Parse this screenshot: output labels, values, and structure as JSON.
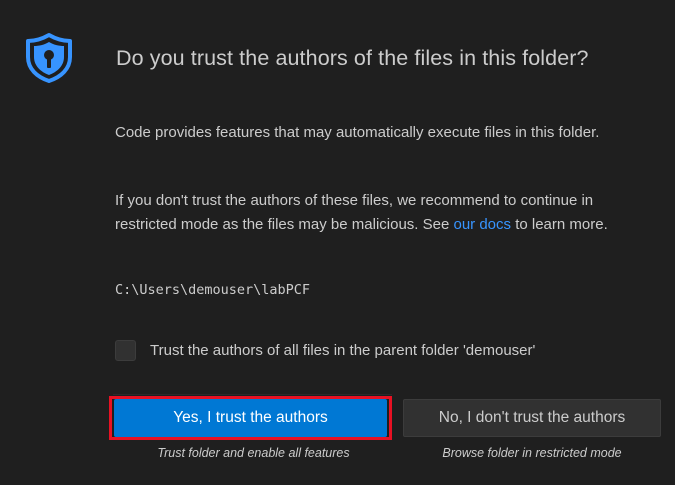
{
  "dialog": {
    "title": "Do you trust the authors of the files in this folder?",
    "paragraph1": "Code provides features that may automatically execute files in this folder.",
    "paragraph2_before_link": "If you don't trust the authors of these files, we recommend to continue in restricted mode as the files may be malicious. See ",
    "paragraph2_link": "our docs",
    "paragraph2_after_link": " to learn more.",
    "folder_path": "C:\\Users\\demouser\\labPCF",
    "parent_checkbox_label": "Trust the authors of all files in the parent folder 'demouser'",
    "parent_checkbox_checked": false,
    "trust_button_label": "Yes, I trust the authors",
    "trust_button_caption": "Trust folder and enable all features",
    "no_trust_button_label": "No, I don't trust the authors",
    "no_trust_button_caption": "Browse folder in restricted mode",
    "icon": "shield-lock-icon"
  },
  "colors": {
    "background": "#1f1f1f",
    "text": "#cccccc",
    "link": "#3794ff",
    "primary_button": "#0078d4",
    "secondary_button": "#313131",
    "icon": "#3794ff",
    "highlight": "#e81123"
  }
}
